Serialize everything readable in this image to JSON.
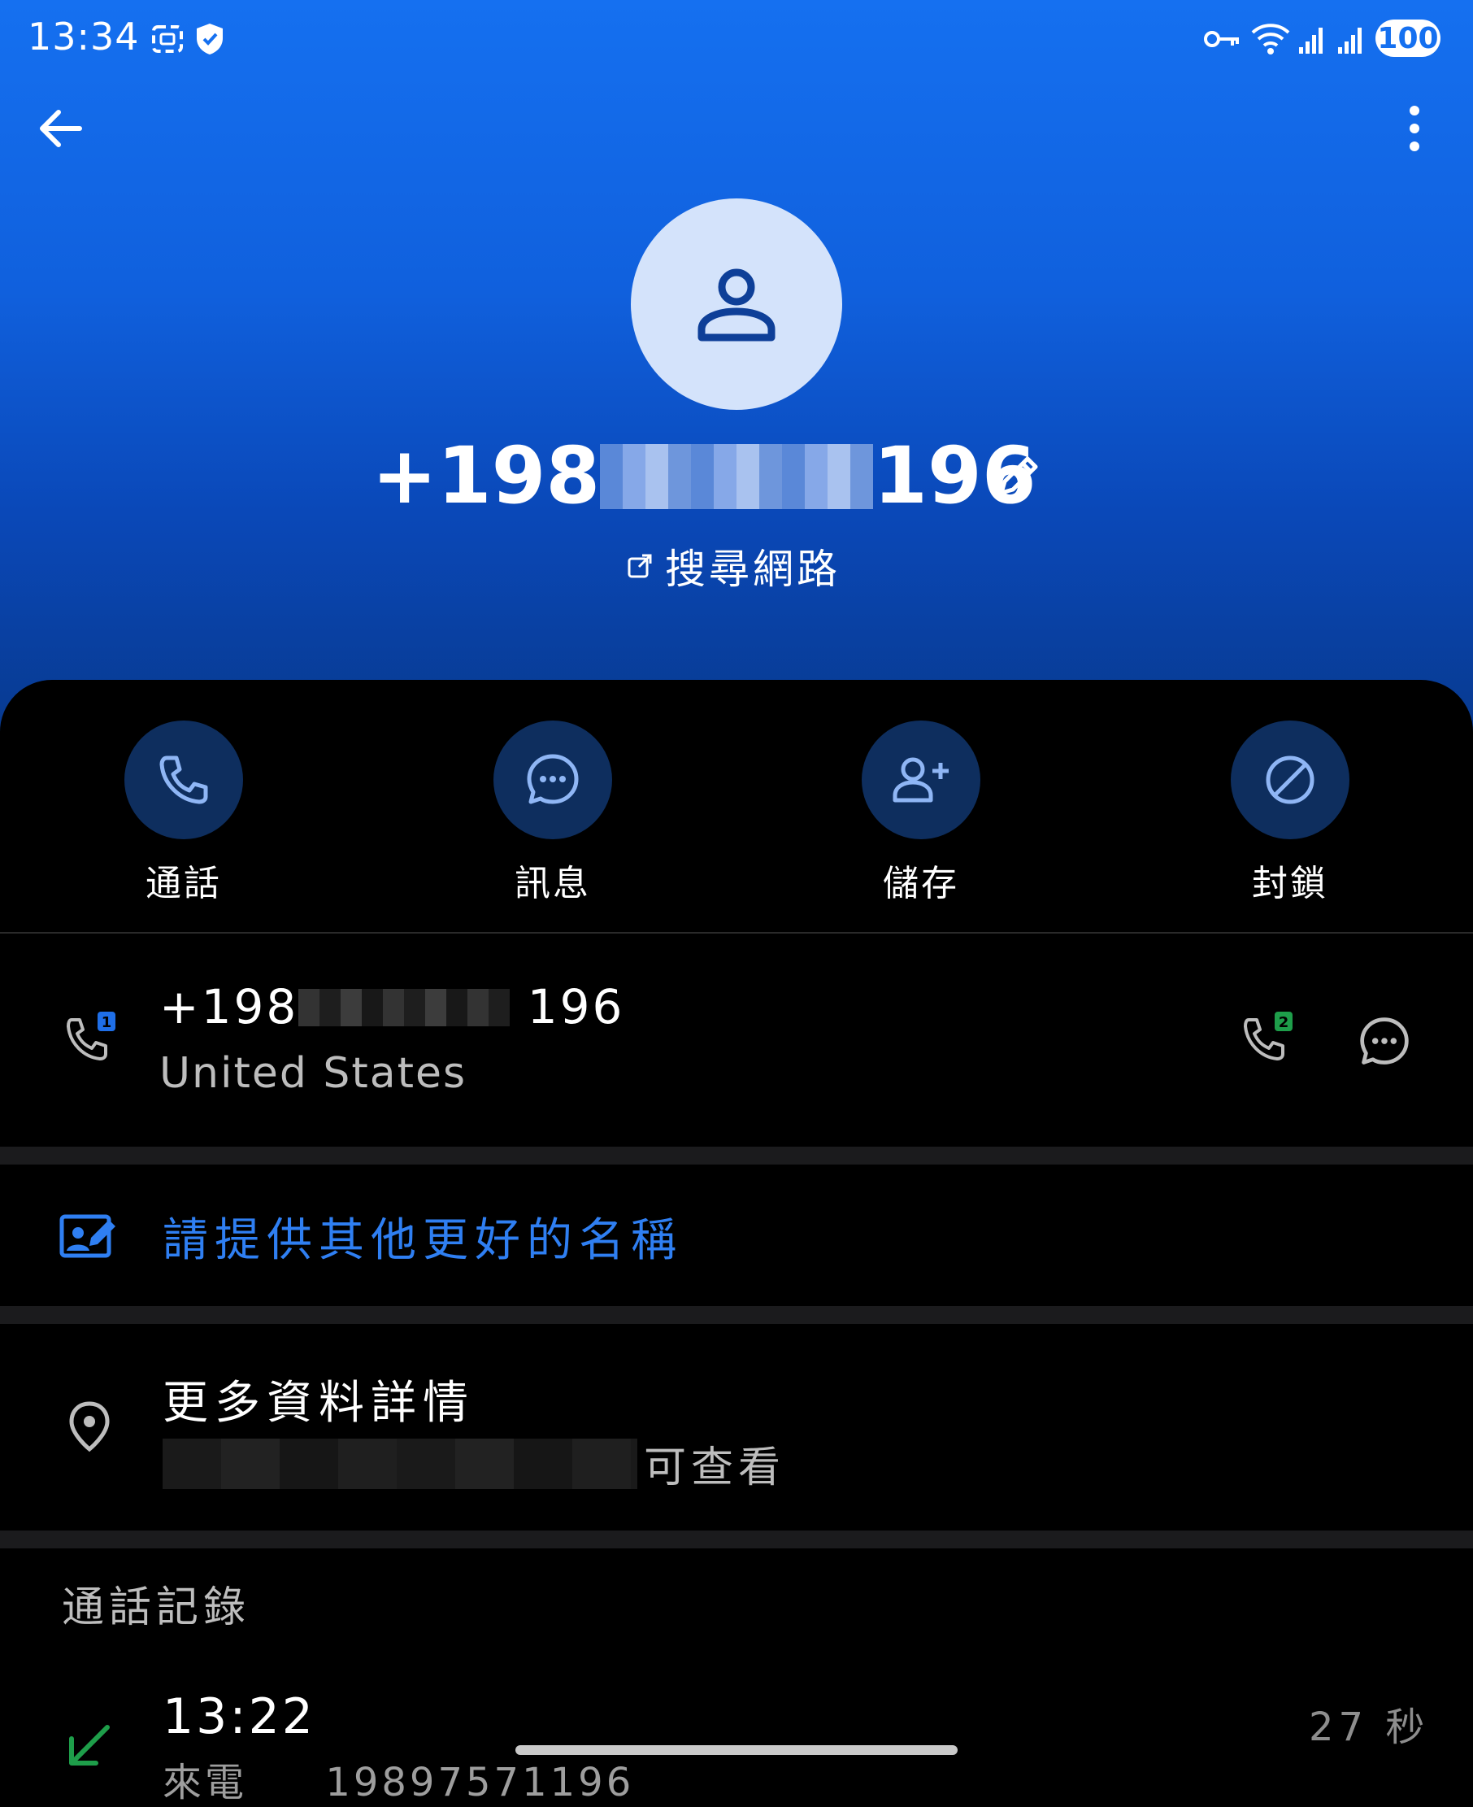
{
  "status_bar": {
    "time": "13:34",
    "battery": "100"
  },
  "header": {
    "phone_prefix": "+198",
    "phone_suffix": "196",
    "search_web_label": "搜尋網路"
  },
  "actions": [
    {
      "label": "通話",
      "icon": "phone-icon"
    },
    {
      "label": "訊息",
      "icon": "chat-icon"
    },
    {
      "label": "儲存",
      "icon": "add-person-icon"
    },
    {
      "label": "封鎖",
      "icon": "block-icon"
    }
  ],
  "number_row": {
    "prefix": "+198",
    "suffix": "196",
    "country": "United States",
    "sim1_badge": "1",
    "sim2_badge": "2"
  },
  "suggest_name": {
    "label": "請提供其他更好的名稱"
  },
  "more_details": {
    "title": "更多資料詳情",
    "suffix": "可查看"
  },
  "call_history": {
    "heading": "通話記錄",
    "entries": [
      {
        "time": "13:22",
        "duration": "27 秒",
        "type": "來電",
        "number": "19897571196"
      }
    ]
  },
  "colors": {
    "header_top": "#1570f0",
    "accent_blue": "#2f7ff2",
    "action_circle": "#0e2e5e",
    "incoming_green": "#1e9e4a",
    "sim1": "#1f6fe8",
    "sim2": "#1e9e4a"
  }
}
